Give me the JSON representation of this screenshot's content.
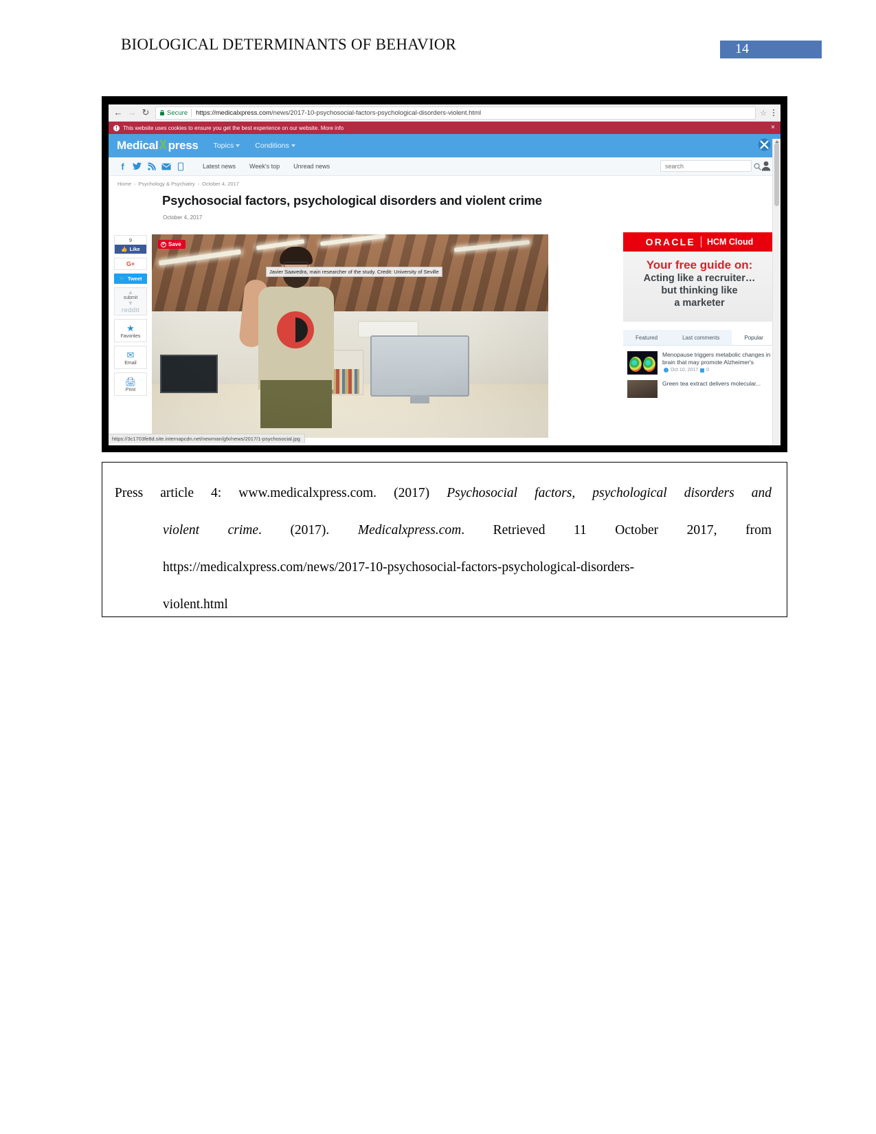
{
  "document": {
    "running_header": "BIOLOGICAL DETERMINANTS OF BEHAVIOR",
    "page_number": "14"
  },
  "browser": {
    "nav": {
      "back_icon": "arrow-left",
      "forward_icon": "arrow-right",
      "reload_icon": "reload",
      "bookmark_icon": "star",
      "menu_icon": "kebab-menu"
    },
    "omnibox": {
      "secure_label": "Secure",
      "url_host": "https://medicalxpress.com",
      "url_path": "/news/2017-10-psychosocial-factors-psychological-disorders-violent.html"
    },
    "status_url": "https://3c1703fe8d.site.internapcdn.net/newman/gfx/news/2017/1-psychosocial.jpg"
  },
  "cookie_bar": {
    "message": "This website uses cookies to ensure you get the best experience on our website.",
    "link": "More info",
    "close_label": "×"
  },
  "site": {
    "brand_left": "Medical",
    "brand_dna": "X",
    "brand_right": "press",
    "masthead_links": [
      {
        "label": "Topics",
        "has_caret": true
      },
      {
        "label": "Conditions",
        "has_caret": true
      }
    ],
    "close_icon_name": "masthead-close-icon",
    "social_icons": [
      "facebook-icon",
      "twitter-icon",
      "rss-icon",
      "email-icon",
      "mobile-icon"
    ],
    "social_glyphs": [
      "f",
      "🐦",
      "◔",
      "✉",
      "▯"
    ],
    "subnav_links": [
      "Latest news",
      "Week's top",
      "Unread news"
    ],
    "search_placeholder": "search",
    "search_value": "",
    "account_icon": "user-icon"
  },
  "article": {
    "breadcrumb": [
      "Home",
      "Psychology & Psychiatry",
      "October 4, 2017"
    ],
    "title": "Psychosocial factors, psychological disorders and violent crime",
    "date": "October 4, 2017",
    "image_caption": "Javier Saavedra, main researcher of the study. Credit: University of Seville",
    "save_badge": "Save"
  },
  "share": {
    "fb_count": "9",
    "fb_like": "Like",
    "gplus": "G+",
    "tweet": "Tweet",
    "reddit_submit": "submit",
    "reddit_word": "reddit",
    "favorites": "Favorites",
    "email": "Email",
    "print": "Print"
  },
  "ad": {
    "brand": "ORACLE",
    "product": "HCM Cloud",
    "headline": "Your free guide on:",
    "line2": "Acting like a recruiter…",
    "line3": "but thinking like",
    "line4": "a marketer"
  },
  "rail": {
    "tabs": [
      {
        "label": "Featured",
        "active": false
      },
      {
        "label": "Last comments",
        "active": false
      },
      {
        "label": "Popular",
        "active": true
      }
    ],
    "items": [
      {
        "title": "Menopause triggers metabolic changes in brain that may promote Alzheimer's",
        "date": "Oct 10, 2017",
        "comments": "0"
      },
      {
        "title": "Green tea extract delivers molecular..."
      }
    ]
  },
  "caption": {
    "line1_plain_a": "Press article 4: www.medicalxpress.com. (2017) ",
    "line1_italic": "Psychosocial factors, psychological disorders and",
    "line2_italic_a": "violent crime",
    "line2_plain_a": ". (2017). ",
    "line2_italic_b": "Medicalxpress.com",
    "line2_plain_b": ". Retrieved 11 October 2017, from",
    "line3": "https://medicalxpress.com/news/2017-10-psychosocial-factors-psychological-disorders-",
    "line4": "violent.html"
  }
}
